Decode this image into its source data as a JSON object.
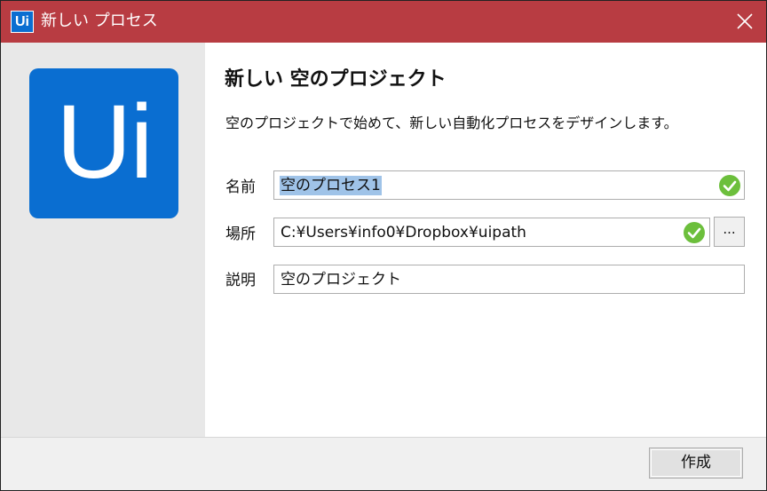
{
  "window": {
    "app_icon_text": "Ui",
    "title": "新しい プロセス",
    "close_icon": "close-icon"
  },
  "logo_text": "Ui",
  "heading": "新しい 空のプロジェクト",
  "description": "空のプロジェクトで始めて、新しい自動化プロセスをデザインします。",
  "fields": {
    "name": {
      "label": "名前",
      "value": "空のプロセス1",
      "valid": true
    },
    "location": {
      "label": "場所",
      "value": "C:¥Users¥info0¥Dropbox¥uipath",
      "valid": true,
      "browse_label": "..."
    },
    "description": {
      "label": "説明",
      "value": "空のプロジェクト"
    }
  },
  "footer": {
    "create_label": "作成"
  },
  "colors": {
    "titlebar": "#b83c42",
    "brand_blue": "#0a6ed1",
    "valid_green": "#6cbf3c",
    "selection": "#9fc3e8"
  }
}
